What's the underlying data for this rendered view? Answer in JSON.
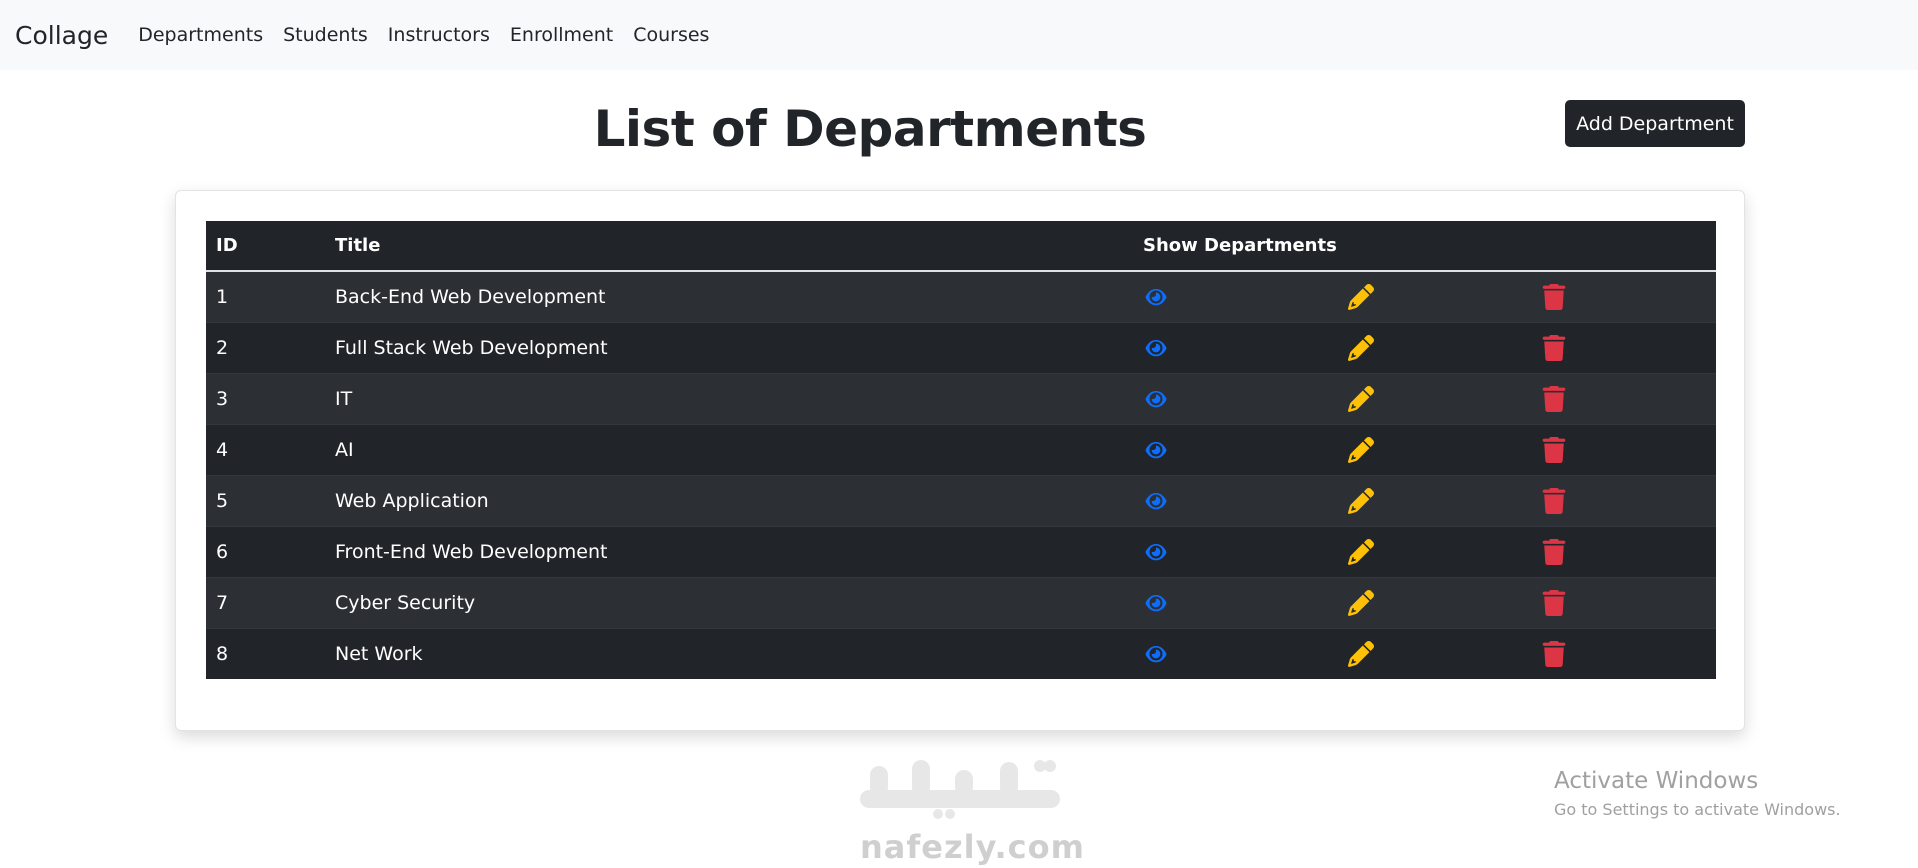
{
  "navbar": {
    "brand": "Collage",
    "links": [
      "Departments",
      "Students",
      "Instructors",
      "Enrollment",
      "Courses"
    ]
  },
  "page": {
    "title": "List of Departments",
    "add_button_label": "Add Department"
  },
  "table": {
    "headers": {
      "id": "ID",
      "title": "Title",
      "show": "Show Departments"
    },
    "rows": [
      {
        "id": "1",
        "title": "Back-End Web Development"
      },
      {
        "id": "2",
        "title": "Full Stack Web Development"
      },
      {
        "id": "3",
        "title": "IT"
      },
      {
        "id": "4",
        "title": "AI"
      },
      {
        "id": "5",
        "title": "Web Application"
      },
      {
        "id": "6",
        "title": "Front-End Web Development"
      },
      {
        "id": "7",
        "title": "Cyber Security"
      },
      {
        "id": "8",
        "title": "Net Work"
      }
    ],
    "row_icons": {
      "show": "eye-icon",
      "edit": "pencil-icon",
      "delete": "trash-icon"
    }
  },
  "colors": {
    "navbar_bg": "#f8f9fa",
    "table_dark": "#212529",
    "table_stripe": "#2c3034",
    "show_icon": "#0d6efd",
    "edit_icon": "#ffc107",
    "delete_icon": "#dc3545"
  },
  "watermark": {
    "site_text": "nafezly.com"
  },
  "os_overlay": {
    "activate_title": "Activate Windows",
    "activate_subtitle": "Go to Settings to activate Windows."
  }
}
